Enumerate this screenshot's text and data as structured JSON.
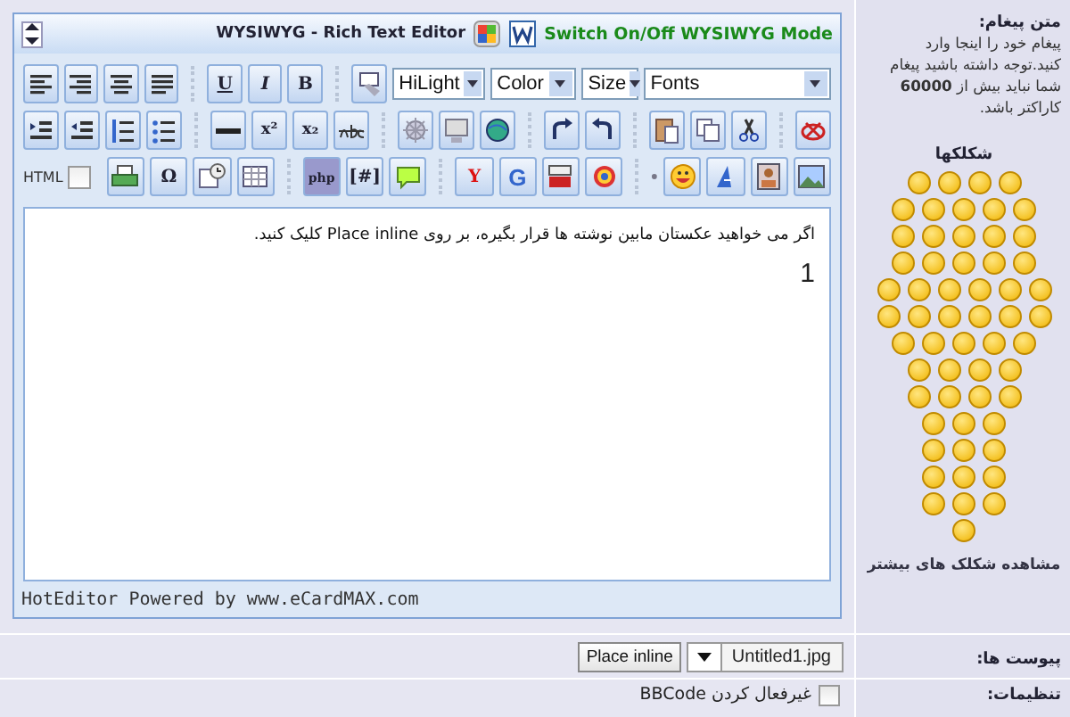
{
  "editor": {
    "title": "WYSIWYG - Rich Text Editor",
    "mode_link": "Switch On/Off WYSIWYG Mode",
    "toolbar": {
      "glyphs": {
        "bold": "B",
        "italic": "I",
        "underline": "U",
        "superscript": "x²",
        "subscript": "x₂",
        "special_character": "Ω",
        "php": "php",
        "code": "[#]",
        "yahoo": "Y",
        "google": "G"
      },
      "selects": {
        "highlight": "HiLight",
        "text_color": "Color",
        "size": "Size",
        "font": "Fonts"
      },
      "html_toggle": {
        "label": "HTML",
        "checked": false
      }
    },
    "content": {
      "paragraph": "اگر می خواهید عکستان مابین نوشته ها قرار بگیره، بر روی Place inline کلیک کنید.",
      "line": "1"
    },
    "footer": "HotEditor Powered by www.eCardMAX.com"
  },
  "sidebar": {
    "heading": "متن پیغام:",
    "hint": "پیغام خود را اینجا وارد کنید.توجه داشته باشید پیغام شما نباید بیش از **60000** کاراکتر باشد.",
    "smileys_heading": "شکلکها",
    "more_smileys": "مشاهده شکلک های بیشتر"
  },
  "attachments": {
    "label": "پیوست ها:",
    "file": "Untitled1.jpg",
    "place_button": "Place inline"
  },
  "settings": {
    "label": "تنظیمات:",
    "disable_bbcode": {
      "label": "غیرفعال کردن BBCode",
      "checked": false
    }
  }
}
